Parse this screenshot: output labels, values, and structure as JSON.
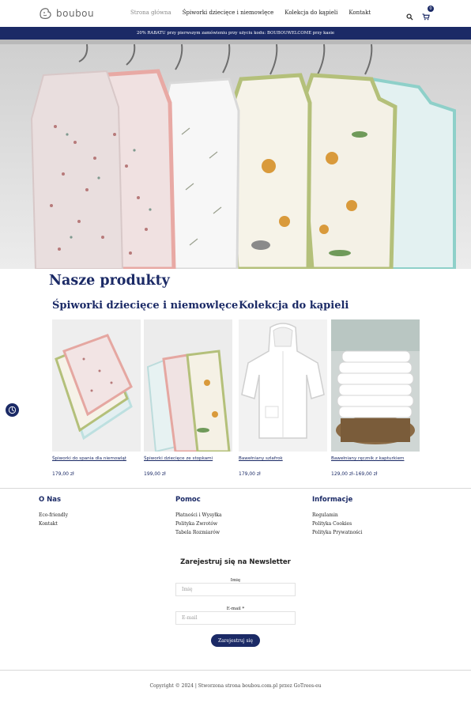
{
  "header": {
    "logo_text": "boubou",
    "nav": [
      {
        "label": "Strona główna",
        "active": true
      },
      {
        "label": "Śpiworki dziecięce i niemowlęce",
        "active": false
      },
      {
        "label": "Kolekcja do kąpieli",
        "active": false
      },
      {
        "label": "Kontakt",
        "active": false
      }
    ],
    "search_icon": "search-icon",
    "cart_icon": "cart-icon",
    "cart_count": "0"
  },
  "promo": {
    "text": "20% RABATU przy pierwszym zamówieniu przy użyciu kodu: BOUBOUWELCOME przy kasie"
  },
  "products": {
    "title": "Nasze produkty",
    "categories": [
      {
        "title": "Śpiworki dziecięce i niemowlęce"
      },
      {
        "title": "Kolekcja do kąpieli"
      }
    ],
    "items": [
      {
        "name": "Śpiworki do spania dla niemowląt",
        "price": "179,00 zł"
      },
      {
        "name": "Śpiworki dziecięce ze stopkami",
        "price": "199,00 zł"
      },
      {
        "name": "Bawełniany szlafrok",
        "price": "179,00 zł"
      },
      {
        "name": "Bawełniany ręcznik z kapturkiem",
        "price": "129,00 zł–169,00 zł"
      }
    ]
  },
  "footer": {
    "columns": [
      {
        "title": "O Nas",
        "links": [
          "Eco-friendly",
          "Kontakt"
        ]
      },
      {
        "title": "Pomoc",
        "links": [
          "Płatności i Wysyłka",
          "Polityka Zwrotów",
          "Tabela Rozmiarów"
        ]
      },
      {
        "title": "Informacje",
        "links": [
          "Regulamin",
          "Polityka Cookies",
          "Polityka Prywatności"
        ]
      }
    ],
    "newsletter": {
      "title": "Zarejestruj się na Newsletter",
      "name_label": "Imię",
      "name_placeholder": "Imię",
      "email_label": "E-mail *",
      "email_placeholder": "E-mail",
      "button": "Zarejestruj się"
    },
    "copyright": "Copyright © 2024 | Stworzona strona boubou.com.pl przez GoTrees-eu"
  },
  "colors": {
    "brand": "#1b2a66",
    "text": "#222222",
    "muted": "#8a8a8a"
  }
}
